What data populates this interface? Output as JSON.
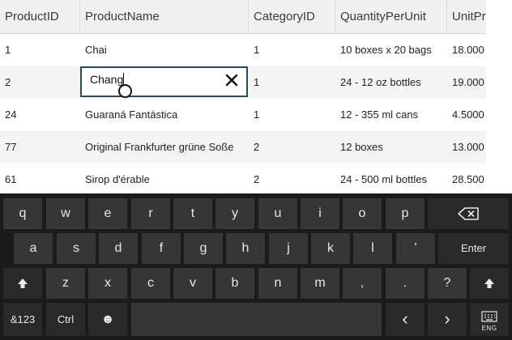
{
  "grid": {
    "columns": [
      "ProductID",
      "ProductName",
      "CategoryID",
      "QuantityPerUnit",
      "UnitPr"
    ],
    "rows": [
      [
        "1",
        "Chai",
        "1",
        "10 boxes x 20 bags",
        "18.000"
      ],
      [
        "2",
        "",
        "1",
        "24 - 12 oz bottles",
        "19.000"
      ],
      [
        "24",
        "Guaraná Fantástica",
        "1",
        "12 - 355 ml cans",
        "4.5000"
      ],
      [
        "77",
        "Original Frankfurter grüne Soße",
        "2",
        "12 boxes",
        "13.000"
      ],
      [
        "61",
        "Sirop d'érable",
        "2",
        "24 - 500 ml bottles",
        "28.500"
      ]
    ],
    "editor": {
      "value": "Chang",
      "clear_icon": "close-icon"
    }
  },
  "keyboard": {
    "row1": [
      "q",
      "w",
      "e",
      "r",
      "t",
      "y",
      "u",
      "i",
      "o",
      "p"
    ],
    "row2": [
      "a",
      "s",
      "d",
      "f",
      "g",
      "h",
      "j",
      "k",
      "l",
      "'"
    ],
    "row3": [
      "z",
      "x",
      "c",
      "v",
      "b",
      "n",
      "m",
      ",",
      ".",
      "?"
    ],
    "enter": "Enter",
    "symbols": "&123",
    "ctrl": "Ctrl",
    "emoji": "☻",
    "left_arrow": "‹",
    "right_arrow": "›",
    "lang": "ENG",
    "icons": {
      "backspace": "backspace-icon",
      "shift": "shift-arrow-icon",
      "keyboard": "keyboard-icon"
    }
  }
}
